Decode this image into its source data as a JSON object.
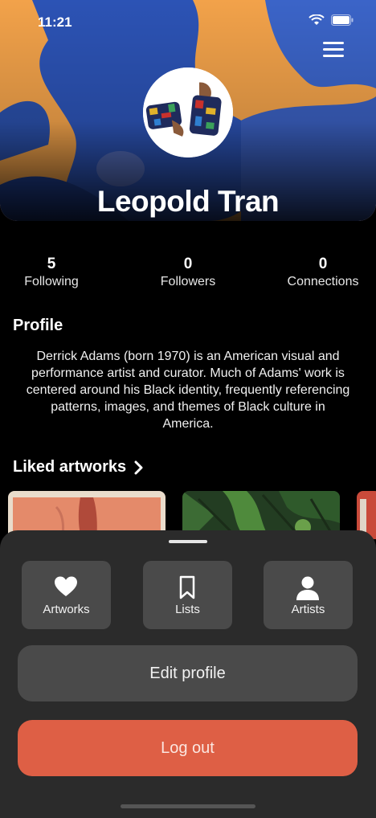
{
  "status_bar": {
    "time": "11:21"
  },
  "profile": {
    "name": "Leopold Tran"
  },
  "stats": [
    {
      "value": "5",
      "label": "Following"
    },
    {
      "value": "0",
      "label": "Followers"
    },
    {
      "value": "0",
      "label": "Connections"
    }
  ],
  "about": {
    "heading": "Profile",
    "bio": "Derrick Adams (born 1970) is an American visual and performance artist and curator. Much of Adams' work is centered around his Black identity, frequently referencing patterns, images, and themes of Black culture in America."
  },
  "liked": {
    "heading": "Liked artworks"
  },
  "sheet": {
    "tiles": [
      {
        "label": "Artworks",
        "icon": "heart-icon"
      },
      {
        "label": "Lists",
        "icon": "bookmark-icon"
      },
      {
        "label": "Artists",
        "icon": "person-icon"
      }
    ],
    "edit_label": "Edit profile",
    "logout_label": "Log out"
  },
  "colors": {
    "accent": "#de5f45",
    "sheet": "#2b2b2b",
    "tile": "#4a4a4a"
  }
}
